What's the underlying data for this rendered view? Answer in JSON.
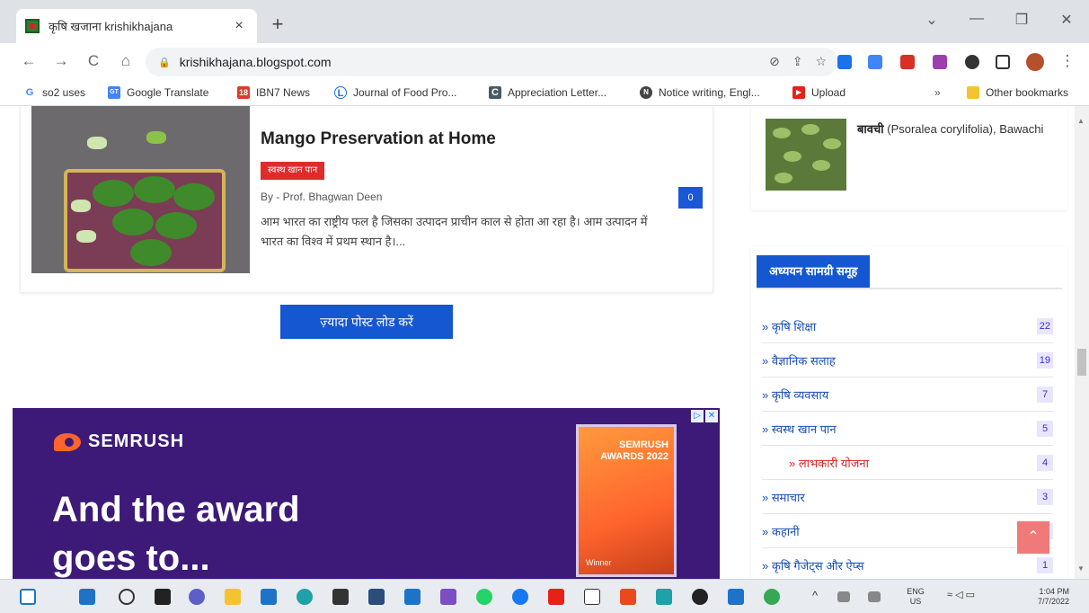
{
  "browser": {
    "tab_title": "कृषि खजाना krishikhajana",
    "tab_close": "×",
    "new_tab": "+",
    "window": {
      "dropdown": "⌄",
      "minimize": "—",
      "restore": "❐",
      "close": "✕"
    },
    "nav": {
      "back": "←",
      "forward": "→",
      "reload": "C",
      "home": "⌂"
    },
    "url": "krishikhajana.blogspot.com",
    "bookmarks": [
      {
        "label": "so2 uses",
        "icon": "G"
      },
      {
        "label": "Google Translate",
        "icon": "GT"
      },
      {
        "label": "IBN7 News",
        "icon": "18"
      },
      {
        "label": "Journal of Food Pro...",
        "icon": "L"
      },
      {
        "label": "Appreciation Letter...",
        "icon": "C"
      },
      {
        "label": "Notice writing, Engl...",
        "icon": "N"
      },
      {
        "label": "Upload",
        "icon": "▶"
      }
    ],
    "bookmarks_more": "»",
    "other_bookmarks": "Other bookmarks"
  },
  "post": {
    "title": "Mango Preservation at Home",
    "tag": "स्वस्थ खान पान",
    "author": "By - Prof. Bhagwan Deen",
    "excerpt": "आम भारत का राष्ट्रीय फल है जिसका उत्पादन प्राचीन काल से होता आ रहा है। आम उत्पादन में भारत का विश्व में प्रथम स्थान है।...",
    "comments": "0"
  },
  "load_more": "ज़्यादा पोस्ट लोड करें",
  "ad": {
    "brand": "SEMRUSH",
    "headline_1": "And the award",
    "headline_2": "goes to...",
    "award_text": "SEMRUSH AWARDS 2022",
    "award_foot": "Winner",
    "corner_info": "▷",
    "corner_close": "✕"
  },
  "sidebar": {
    "featured": {
      "title_hi": "बावची",
      "title_rest": " (Psoralea corylifolia), Bawachi"
    },
    "widget_title": "अध्ययन सामग्री समूह",
    "categories": [
      {
        "label": "» कृषि शिक्षा",
        "count": "22"
      },
      {
        "label": "» वैज्ञानिक सलाह",
        "count": "19"
      },
      {
        "label": "» कृषि व्यवसाय",
        "count": "7"
      },
      {
        "label": "» स्वस्थ खान पान",
        "count": "5"
      },
      {
        "label": "» लाभकारी योजना",
        "count": "4"
      },
      {
        "label": "» समाचार",
        "count": "3"
      },
      {
        "label": "» कहानी",
        "count": ""
      },
      {
        "label": "» कृषि गैजेट्स और ऐप्स",
        "count": "1"
      }
    ],
    "to_top": "⌃"
  },
  "taskbar": {
    "lang_1": "ENG",
    "lang_2": "US",
    "time": "1:04 PM",
    "date": "7/7/2022",
    "chevron": "^"
  }
}
